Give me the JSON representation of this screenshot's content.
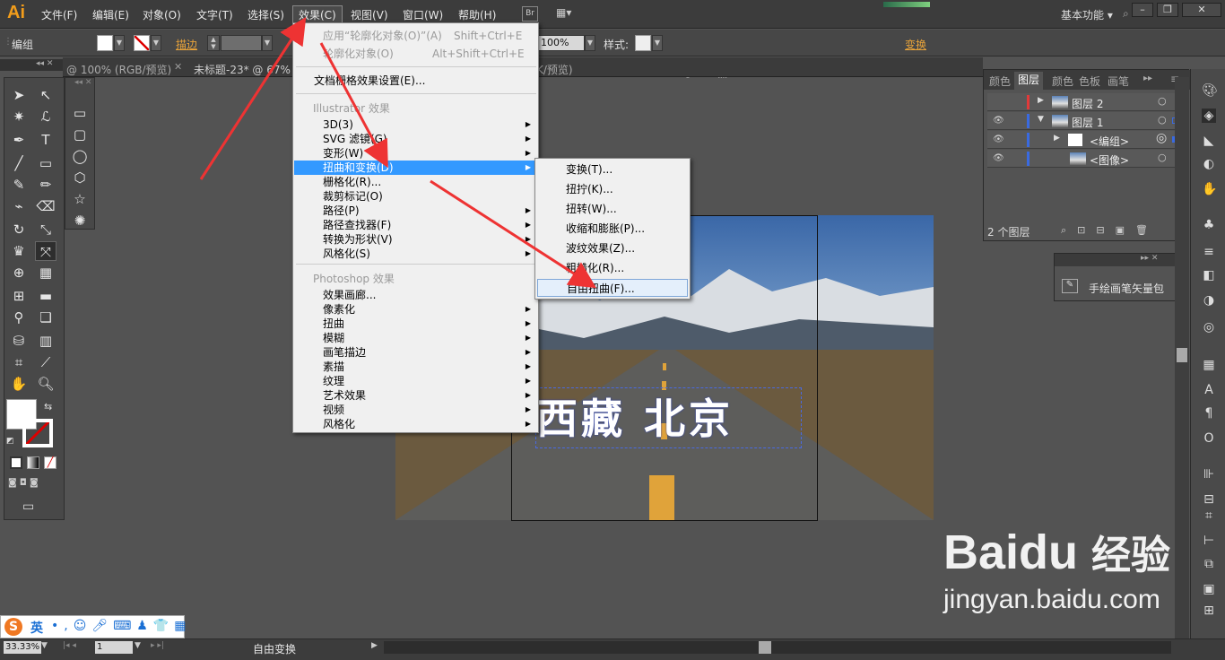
{
  "app": {
    "logo": "Ai"
  },
  "menubar": {
    "items": [
      "文件(F)",
      "编辑(E)",
      "对象(O)",
      "文字(T)",
      "选择(S)",
      "效果(C)",
      "视图(V)",
      "窗口(W)",
      "帮助(H)"
    ],
    "bridge_label": "Br",
    "workspace": "基本功能"
  },
  "control_bar": {
    "selection_label": "编组",
    "stroke_label": "描边",
    "opacity_value": "100%",
    "style_label": "样式:",
    "transform_label": "变换"
  },
  "doc_tabs": [
    "@ 100% (RGB/预览)",
    "未标题-23* @ 67%",
    "K/预览)"
  ],
  "effect_menu": {
    "apply_last": "应用“轮廓化对象(O)”(A)",
    "apply_last_shortcut": "Shift+Ctrl+E",
    "last_effect": "轮廓化对象(O)",
    "last_effect_shortcut": "Alt+Shift+Ctrl+E",
    "raster_settings": "文档栅格效果设置(E)...",
    "illustrator_section": "Illustrator 效果",
    "illustrator_items": [
      "3D(3)",
      "SVG 滤镜(G)",
      "变形(W)",
      "扭曲和变换(D)",
      "栅格化(R)...",
      "裁剪标记(O)",
      "路径(P)",
      "路径查找器(F)",
      "转换为形状(V)",
      "风格化(S)"
    ],
    "photoshop_section": "Photoshop 效果",
    "photoshop_items": [
      "效果画廊...",
      "像素化",
      "扭曲",
      "模糊",
      "画笔描边",
      "素描",
      "纹理",
      "艺术效果",
      "视频",
      "风格化"
    ]
  },
  "distort_submenu": {
    "items": [
      "变换(T)...",
      "扭拧(K)...",
      "扭转(W)...",
      "收缩和膨胀(P)...",
      "波纹效果(Z)...",
      "粗糙化(R)...",
      "自由扭曲(F)..."
    ],
    "highlighted": "自由扭曲(F)..."
  },
  "artwork": {
    "text": "西藏 北京"
  },
  "layers_panel": {
    "tabs": [
      "颜色",
      "图层",
      "颜色",
      "色板",
      "画笔"
    ],
    "active_tab": "图层",
    "rows": [
      {
        "name": "图层 2",
        "color": "#e03a3a"
      },
      {
        "name": "图层 1",
        "color": "#3a6ae0"
      },
      {
        "name": "<编组>",
        "color": "#3a6ae0"
      },
      {
        "name": "<图像>",
        "color": "#3a6ae0"
      }
    ],
    "footer": "2 个图层"
  },
  "brush_panel": {
    "item": "手绘画笔矢量包"
  },
  "status_bar": {
    "zoom": "33.33%",
    "page": "1",
    "tool_status": "自由变换"
  },
  "ime": {
    "lang": "英"
  },
  "watermark": {
    "brand": "Baidu",
    "cn": "经验",
    "url": "jingyan.baidu.com"
  }
}
